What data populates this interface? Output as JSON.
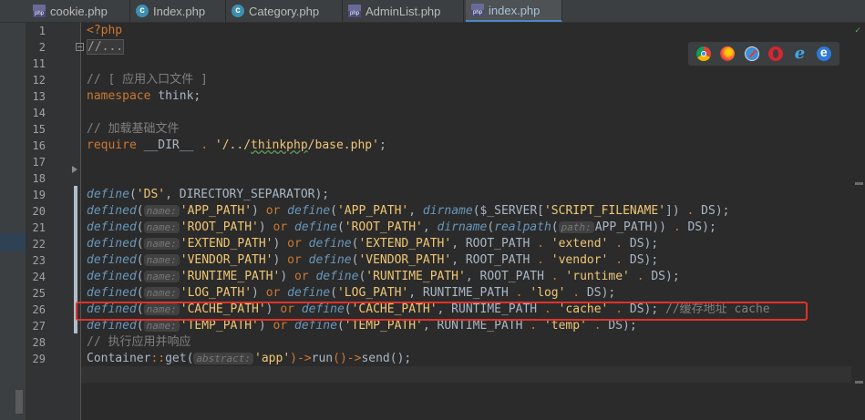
{
  "tabs": [
    {
      "label": "cookie.php",
      "icon": "php-file-icon",
      "active": false
    },
    {
      "label": "Index.php",
      "icon": "class-file-icon",
      "active": false
    },
    {
      "label": "Category.php",
      "icon": "class-file-icon",
      "active": false
    },
    {
      "label": "AdminList.php",
      "icon": "php-file-icon",
      "active": false
    },
    {
      "label": "index.php",
      "icon": "php-file-icon",
      "active": true
    }
  ],
  "line_numbers": [
    "1",
    "2",
    "11",
    "12",
    "13",
    "14",
    "15",
    "16",
    "17",
    "18",
    "19",
    "20",
    "21",
    "22",
    "23",
    "24",
    "25",
    "26",
    "27",
    "28",
    "29"
  ],
  "code": {
    "l1": "<?php",
    "l2": "//...",
    "l12_comment": "// [ 应用入口文件 ]",
    "l13_kw": "namespace",
    "l13_rest": " think;",
    "l15_comment": "// 加载基础文件",
    "l16_kw": "require",
    "l16_dir": " __DIR__ ",
    "l16_dot": ".",
    "l16_str_a": " '/../",
    "l16_str_b": "thinkphp",
    "l16_str_c": "/base.php'",
    "l16_end": ";",
    "l19": [
      "define",
      "(",
      "'DS'",
      ", DIRECTORY_SEPARATOR);"
    ],
    "define_rows": [
      {
        "key": "'APP_PATH'",
        "value": "dirname($_SERVER['SCRIPT_FILENAME']) . DS"
      },
      {
        "key": "'ROOT_PATH'",
        "value": "dirname(realpath(APP_PATH)) . DS"
      },
      {
        "key": "'EXTEND_PATH'",
        "value": "ROOT_PATH . 'extend' . DS"
      },
      {
        "key": "'VENDOR_PATH'",
        "value": "ROOT_PATH . 'vendor' . DS"
      },
      {
        "key": "'RUNTIME_PATH'",
        "value": "ROOT_PATH . 'runtime' . DS"
      },
      {
        "key": "'LOG_PATH'",
        "value": "RUNTIME_PATH . 'log' . DS"
      },
      {
        "key": "'CACHE_PATH'",
        "value": "RUNTIME_PATH . 'cache' . DS"
      },
      {
        "key": "'TEMP_PATH'",
        "value": "RUNTIME_PATH . 'temp' . DS"
      }
    ],
    "hint_name": "name:",
    "hint_path": "path:",
    "hint_abstract": "abstract:",
    "kw_defined": "defined",
    "kw_or": "or",
    "kw_define": "define",
    "l26_comment": "//缓存地址 cache",
    "l28_comment": "// 执行应用并响应",
    "l29_class": "Container",
    "l29_sep": "::",
    "l29_get": "get(",
    "l29_arg": "'app'",
    "l29_rest_a": ")->",
    "l29_run": "run",
    "l29_rest_b": "()->",
    "l29_send": "send",
    "l29_end": "();"
  },
  "browsers": [
    "chrome-icon",
    "firefox-icon",
    "safari-icon",
    "opera-icon",
    "ie-icon",
    "edge-icon"
  ],
  "colors": {
    "editor_bg": "#2b2b2b",
    "keyword": "#cc7832",
    "string": "#f0c674",
    "function": "#6897bb",
    "comment": "#808080",
    "highlight_box": "#e0322b"
  }
}
